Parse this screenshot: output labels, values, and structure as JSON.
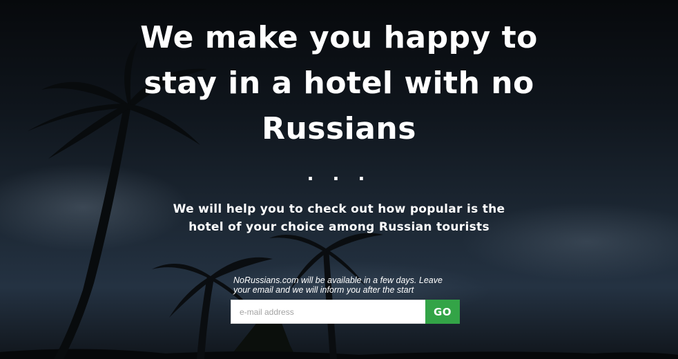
{
  "hero": {
    "headline_lines": [
      "We make you happy to",
      "stay in a hotel with no",
      "Russians"
    ],
    "separator": ". . .",
    "subheadline_lines": [
      "We will help you to check out how popular is the",
      "hotel of your choice among Russian tourists"
    ]
  },
  "signup": {
    "notice_lines": [
      "NoRussians.com will be available in a few days. Leave",
      "your email and we will inform you after the start"
    ],
    "email_placeholder": "e-mail address",
    "email_value": "",
    "go_label": "GO"
  },
  "colors": {
    "go_button": "#33a447",
    "text": "#ffffff"
  },
  "icons": [
    "palm-tree-silhouette-left",
    "palm-tree-silhouette-center",
    "palm-tree-silhouette-right"
  ]
}
